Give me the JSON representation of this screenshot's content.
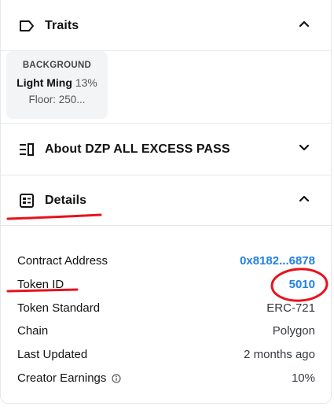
{
  "traits": {
    "title": "Traits",
    "items": [
      {
        "trait_type": "BACKGROUND",
        "value": "Light Ming",
        "percent": "13%",
        "floor": "Floor: 250..."
      }
    ]
  },
  "about": {
    "title": "About DZP ALL EXCESS PASS"
  },
  "details": {
    "title": "Details",
    "rows": [
      {
        "label": "Contract Address",
        "value": "0x8182...6878"
      },
      {
        "label": "Token ID",
        "value": "5010"
      },
      {
        "label": "Token Standard",
        "value": "ERC-721"
      },
      {
        "label": "Chain",
        "value": "Polygon"
      },
      {
        "label": "Last Updated",
        "value": "2 months ago"
      },
      {
        "label": "Creator Earnings",
        "value": "10%"
      }
    ]
  },
  "colors": {
    "link": "#2081e2",
    "annotation": "#e8121c",
    "border": "#e5e8eb",
    "card": "#f3f4f6"
  },
  "icons": [
    "tag-icon",
    "chevron-up-icon",
    "list-icon",
    "chevron-down-icon",
    "details-icon",
    "info-icon"
  ]
}
